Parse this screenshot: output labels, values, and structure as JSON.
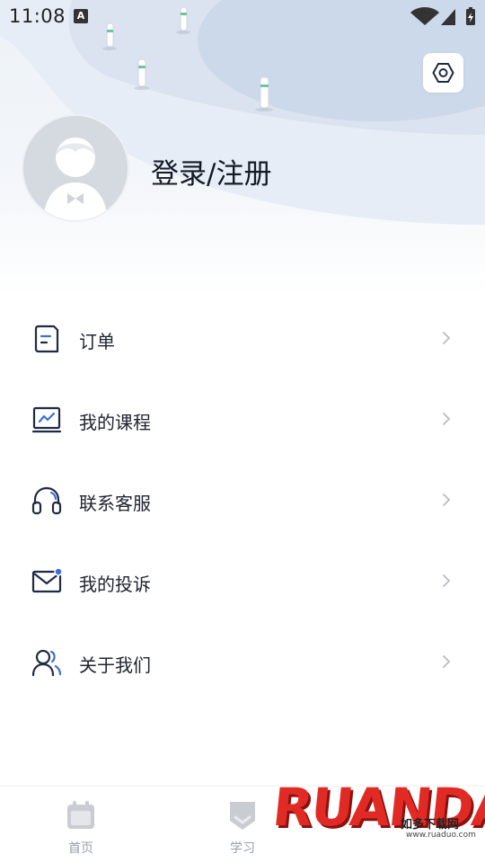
{
  "status_bar": {
    "time": "11:08",
    "notification_badge": "A"
  },
  "header": {
    "login_register": "登录/注册",
    "settings_icon": "hexagon-settings-icon"
  },
  "menu": [
    {
      "label": "订单",
      "icon": "order-doc-icon"
    },
    {
      "label": "我的课程",
      "icon": "course-chart-icon"
    },
    {
      "label": "联系客服",
      "icon": "headset-icon"
    },
    {
      "label": "我的投诉",
      "icon": "mail-icon"
    },
    {
      "label": "关于我们",
      "icon": "users-icon"
    }
  ],
  "tabbar": {
    "tabs": [
      {
        "label": "首页",
        "icon": "calendar-icon"
      },
      {
        "label": "学习",
        "icon": "shield-icon"
      }
    ]
  },
  "watermark": {
    "brand": "RUANDAO",
    "subtitle": "如多下载网",
    "url": "www.ruaduo.com"
  },
  "colors": {
    "accent": "#3b6fd8",
    "icon_dark": "#1f2a44",
    "chevron": "#b8bcc4",
    "tab_inactive": "#9aa0a8"
  }
}
